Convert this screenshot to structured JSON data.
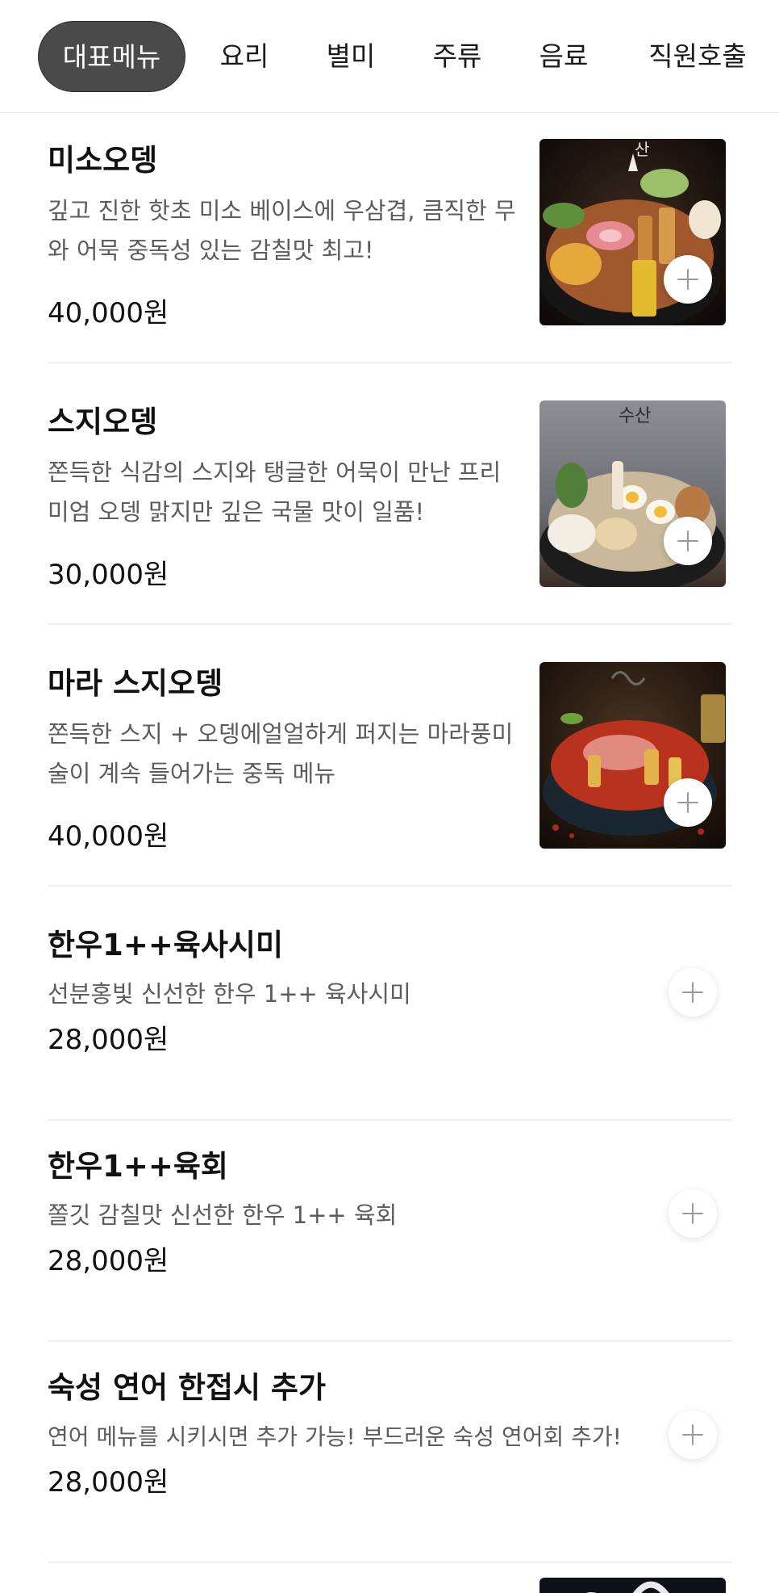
{
  "tabs": [
    {
      "label": "대표메뉴",
      "active": true
    },
    {
      "label": "요리",
      "active": false
    },
    {
      "label": "별미",
      "active": false
    },
    {
      "label": "주류",
      "active": false
    },
    {
      "label": "음료",
      "active": false
    },
    {
      "label": "직원호출",
      "active": false
    }
  ],
  "menu": [
    {
      "name": "미소오뎅",
      "desc_lines": [
        "깊고 진한 핫초 미소 베이스에 우삼겹, 큼직한 무",
        "와 어묵 중독성 있는 감칠맛 최고!"
      ],
      "price": "40,000원",
      "image": "food-photo-miso-oden"
    },
    {
      "name": "스지오뎅",
      "desc_lines": [
        "쫀득한 식감의 스지와 탱글한 어묵이 만난 프리",
        "미엄 오뎅 맑지만 깊은 국물 맛이 일품!"
      ],
      "price": "30,000원",
      "image": "food-photo-suji-oden"
    },
    {
      "name": "마라 스지오뎅",
      "desc_lines": [
        "쫀득한 스지 + 오뎅에얼얼하게 퍼지는 마라풍미",
        "술이 계속 들어가는 중독 메뉴"
      ],
      "price": "40,000원",
      "image": "food-photo-mala-suji-oden"
    },
    {
      "name": "한우1++육사시미",
      "desc_lines": [
        "선분홍빛 신선한 한우 1++ 육사시미"
      ],
      "price": "28,000원",
      "image": null
    },
    {
      "name": "한우1++육회",
      "desc_lines": [
        "쫄깃 감칠맛 신선한 한우 1++ 육회"
      ],
      "price": "28,000원",
      "image": null
    },
    {
      "name": "숙성 연어 한접시 추가",
      "desc_lines": [
        "연어 메뉴를 시키시면 추가 가능! 부드러운 숙성 연어회 추가!"
      ],
      "price": "28,000원",
      "image": null
    }
  ],
  "photo_captions": {
    "miso": "산",
    "suji": "수산"
  },
  "colors": {
    "active_tab_bg": "#4a4a4a",
    "text_primary": "#111111",
    "text_secondary": "#5c5c5c",
    "divider": "#eeeeee",
    "plus_icon": "#9a9a9a"
  }
}
